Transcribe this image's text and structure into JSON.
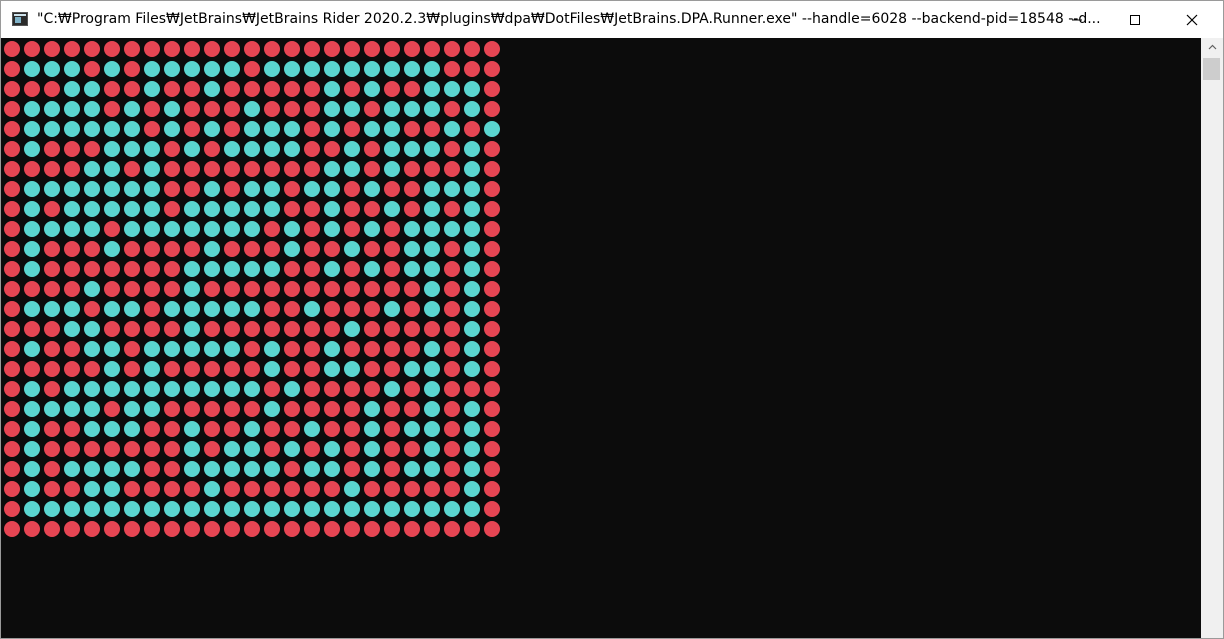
{
  "window": {
    "title": "\"C:₩Program Files₩JetBrains₩JetBrains Rider 2020.2.3₩plugins₩dpa₩DotFiles₩JetBrains.DPA.Runner.exe\" --handle=6028 --backend-pid=18548 --d..."
  },
  "colors": {
    "red": "#e64553",
    "cyan": "#5ad5d0",
    "background": "#0c0c0c"
  },
  "grid": {
    "rows": [
      "RRRRRRRRRRRRRRRRRRRRRRRRR",
      "RCCCRCRCCCCCRCCCCCCCCCRRR",
      "RRRCCRRCRRCRRRRRCRCRRCCCR",
      "RCCCCRCRCRRRCRRRCCRCCCRCR",
      "RCCCCCCRCRCRCCCRCRCCRRCRC",
      "RCRRRCCCRCRCCCCRRCRCCCRCR",
      "RRRRCCRCRRRRRRRRCCRCRRRCR",
      "RCCCCCCCRRCRCCRCCRCRRCCCR",
      "RCRCCCCCRCCCCCRRCRRCRCRCR",
      "RCCCCRCCCCCCCRCRCRCRCCCCR",
      "RCRRRCRRRRCRRRCRRCRRCCRCR",
      "RCRRRRRRRCCCCCRRCRCRCCRCR",
      "RRRRCRRRRCRRRRRRRRRRRCRCR",
      "RCCCRCCRCCCCCRRCRRRCRCRCR",
      "RRRCCRRRRCRRRRRRRCRRRRRCR",
      "RCRRCCRCCCCCRCRRCRRRRCRCR",
      "RRRRRCRCRRRRRCRRCCRRCCRCR",
      "RCRCCCCCCCCCCRCRRRRCRCRRR",
      "RCCCCRCCRRRRRCRRRRCRRCRCR",
      "RCRRCCCRRCRRCRRCRRCRCCRCR",
      "RCRRRRRRRCRCCRCRCRCRRCRCR",
      "RCRCCCCRRCCCCCRCCRCRCCRCR",
      "RCRRCCRRRRCRRRRRRCRRRRRCR",
      "RCCCCCCCCCCCCCCCCCCCCCCCR",
      "RRRRRRRRRRRRRRRRRRRRRRRRR"
    ]
  }
}
